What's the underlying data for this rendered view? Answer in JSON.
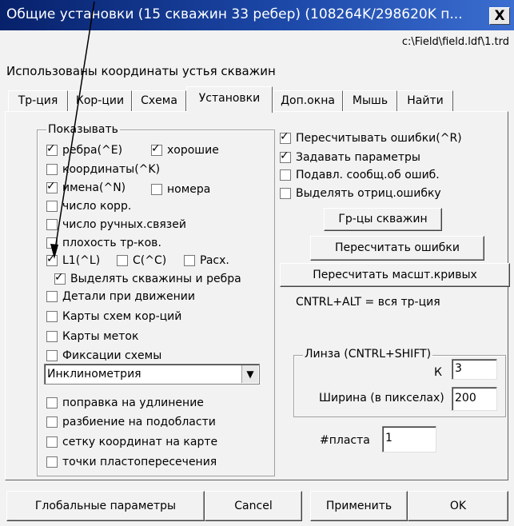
{
  "window": {
    "title": "Общие установки (15 скважин 33 ребер) (108264K/298620K п...",
    "close_label": "X",
    "path": "c:\\Field\\field.ldf\\1.trd",
    "info": "Использованы координаты устья скважин"
  },
  "tabs": [
    {
      "label": "Тр-ция"
    },
    {
      "label": "Кор-ции"
    },
    {
      "label": "Схема"
    },
    {
      "label": "Установки"
    },
    {
      "label": "Доп.окна"
    },
    {
      "label": "Мышь"
    },
    {
      "label": "Найти"
    }
  ],
  "show_group": {
    "caption": "Показывать",
    "items": [
      {
        "label": "ребра(^E)",
        "checked": true
      },
      {
        "label": "хорошие",
        "checked": true
      },
      {
        "label": "координаты(^K)",
        "checked": false
      },
      {
        "label": "имена(^N)",
        "checked": true
      },
      {
        "label": "номера",
        "checked": false
      },
      {
        "label": "число корр.",
        "checked": false
      },
      {
        "label": "число ручных.связей",
        "checked": false
      },
      {
        "label": "плохость тр-ков.",
        "checked": false
      },
      {
        "label": "L1(^L)",
        "checked": true
      },
      {
        "label": "C(^C)",
        "checked": false
      },
      {
        "label": "Pacx.",
        "checked": false
      },
      {
        "label": "Выделять скважины и ребра",
        "checked": true
      },
      {
        "label": "Детали при движении",
        "checked": false
      },
      {
        "label": "Карты схем кор-ций",
        "checked": false
      },
      {
        "label": "Карты меток",
        "checked": false
      },
      {
        "label": "Фиксации схемы",
        "checked": false
      },
      {
        "label": "поправка на удлинение",
        "checked": false
      },
      {
        "label": "разбиение на подобласти",
        "checked": false
      },
      {
        "label": "сетку координат на карте",
        "checked": false
      },
      {
        "label": "точки пластопересечения",
        "checked": false
      }
    ],
    "dropdown_value": "Инклинометрия"
  },
  "right": {
    "options": [
      {
        "label": "Пересчитывать ошибки(^R)",
        "checked": true
      },
      {
        "label": "Задавать параметры",
        "checked": true
      },
      {
        "label": "Подавл. сообщ.об ошиб.",
        "checked": false
      },
      {
        "label": "Выделять отриц.ошибку",
        "checked": false
      }
    ],
    "btn_bounds": "Гр-цы скважин",
    "btn_recalc_errors": "Пересчитать ошибки",
    "btn_recalc_scale": "Пересчитать масшт.кривых",
    "hint": "CNTRL+ALT = вся тр-ция",
    "lens": {
      "caption": "Линза (CNTRL+SHIFT)",
      "k_label": "К",
      "k_value": "3",
      "width_label": "Ширина (в пикселах)",
      "width_value": "200"
    },
    "layer_label": "#пласта",
    "layer_value": "1"
  },
  "footer": {
    "global_params": "Глобальные параметры",
    "cancel": "Cancel",
    "apply": "Применить",
    "ok": "OK"
  },
  "colors": {
    "desktop": "#4e7fc4",
    "titlebar": "#07216b",
    "dialog": "#f2f2f2"
  }
}
